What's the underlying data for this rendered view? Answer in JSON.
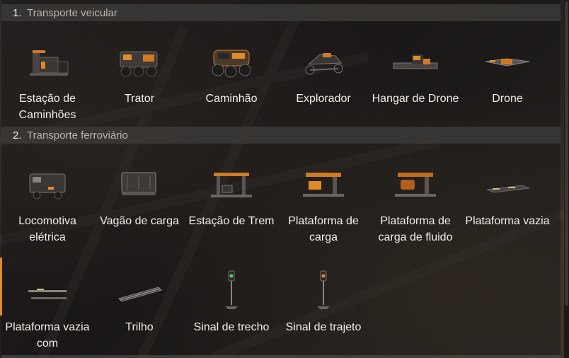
{
  "sections": [
    {
      "number": "1.",
      "title": "Transporte veicular",
      "items": [
        {
          "label": "Estação de Caminhões",
          "icon": "truck-station-icon"
        },
        {
          "label": "Trator",
          "icon": "tractor-icon"
        },
        {
          "label": "Caminhão",
          "icon": "truck-icon"
        },
        {
          "label": "Explorador",
          "icon": "explorer-icon"
        },
        {
          "label": "Hangar de Drone",
          "icon": "drone-hangar-icon"
        },
        {
          "label": "Drone",
          "icon": "drone-icon"
        }
      ]
    },
    {
      "number": "2.",
      "title": "Transporte ferroviário",
      "items": [
        {
          "label": "Locomotiva elétrica",
          "icon": "locomotive-icon"
        },
        {
          "label": "Vagão de carga",
          "icon": "freight-car-icon"
        },
        {
          "label": "Estação de Trem",
          "icon": "train-station-icon"
        },
        {
          "label": "Plataforma de carga",
          "icon": "freight-platform-icon"
        },
        {
          "label": "Plataforma de carga de fluido",
          "icon": "fluid-platform-icon"
        },
        {
          "label": "Plataforma vazia",
          "icon": "empty-platform-icon"
        },
        {
          "label": "Plataforma vazia com",
          "icon": "empty-platform-with-icon"
        },
        {
          "label": "Trilho",
          "icon": "rail-icon"
        },
        {
          "label": "Sinal de trecho",
          "icon": "block-signal-icon"
        },
        {
          "label": "Sinal de trajeto",
          "icon": "path-signal-icon"
        }
      ]
    }
  ],
  "colors": {
    "accent": "#e08a2a",
    "header_bg": "#3a3735",
    "header_title": "#b9b4ae"
  }
}
